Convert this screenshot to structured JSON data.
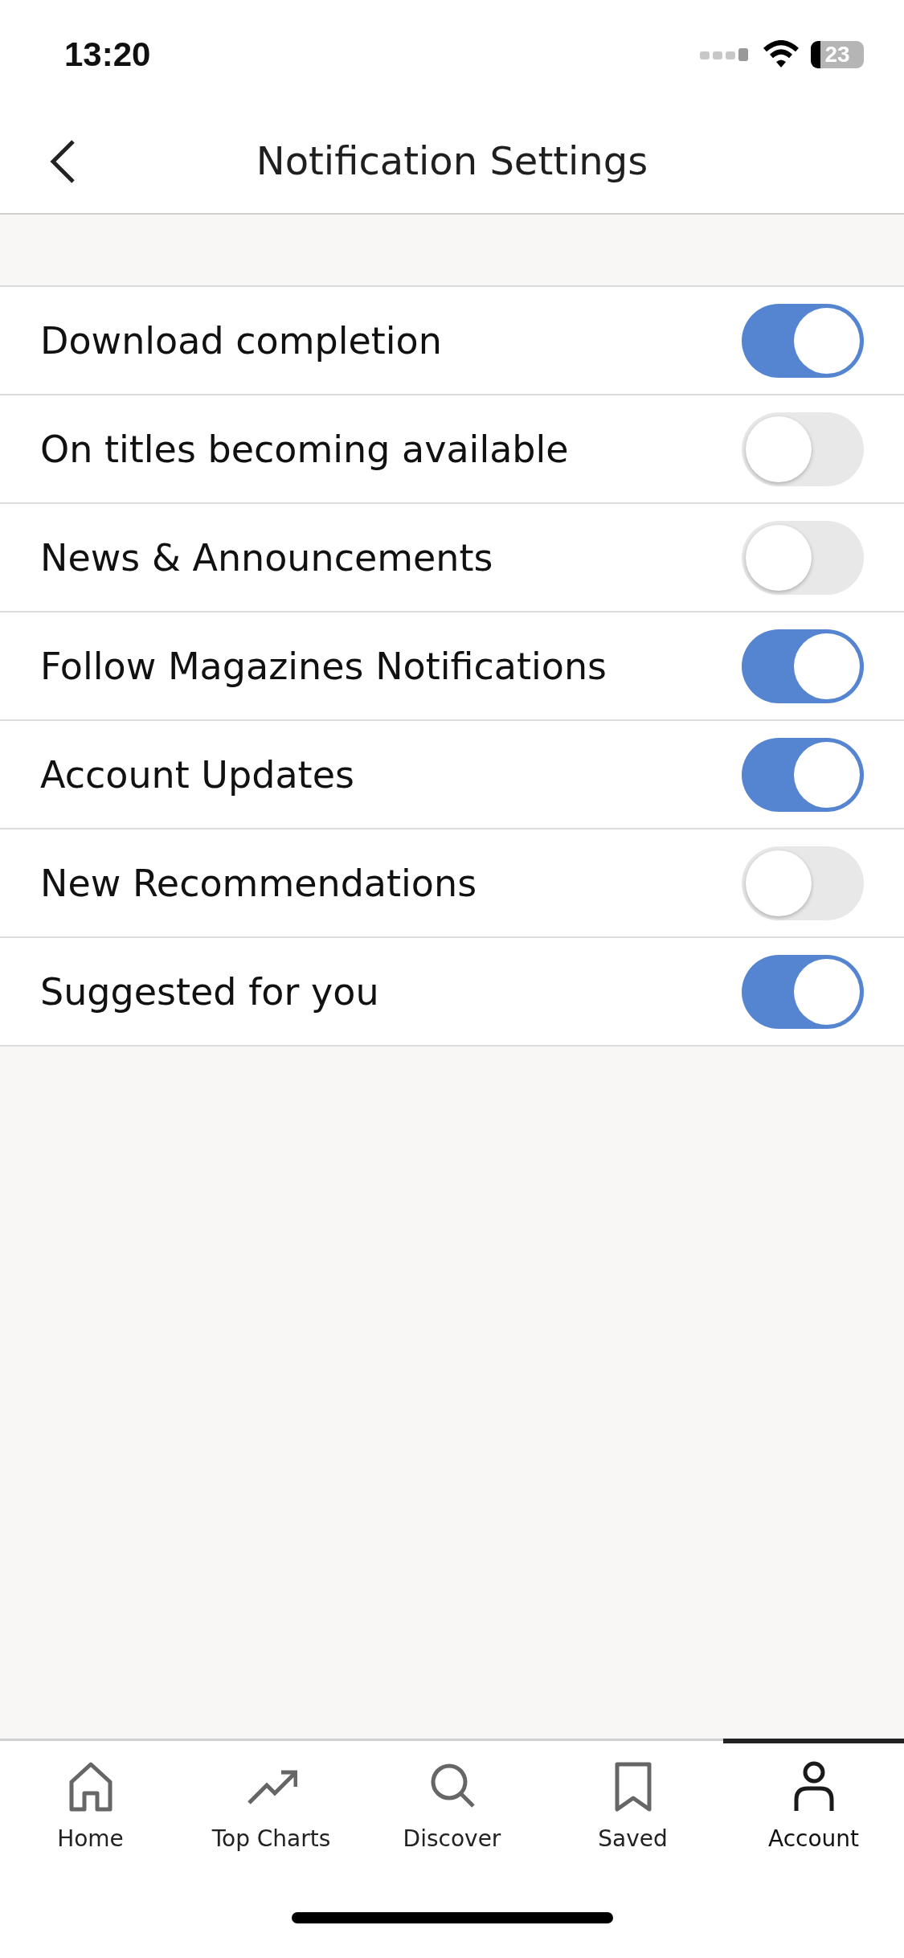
{
  "status_bar": {
    "time": "13:20",
    "battery": "23"
  },
  "nav": {
    "title": "Notification Settings"
  },
  "settings": [
    {
      "label": "Download completion",
      "on": true
    },
    {
      "label": "On titles becoming available",
      "on": false
    },
    {
      "label": "News & Announcements",
      "on": false
    },
    {
      "label": "Follow Magazines Notifications",
      "on": true
    },
    {
      "label": "Account Updates",
      "on": true
    },
    {
      "label": "New Recommendations",
      "on": false
    },
    {
      "label": "Suggested for you",
      "on": true
    }
  ],
  "tab_bar": [
    {
      "label": "Home",
      "kind": "home",
      "selected": false
    },
    {
      "label": "Top Charts",
      "kind": "trend",
      "selected": false
    },
    {
      "label": "Discover",
      "kind": "search",
      "selected": false
    },
    {
      "label": "Saved",
      "kind": "bookmark",
      "selected": false
    },
    {
      "label": "Account",
      "kind": "person",
      "selected": true
    }
  ]
}
